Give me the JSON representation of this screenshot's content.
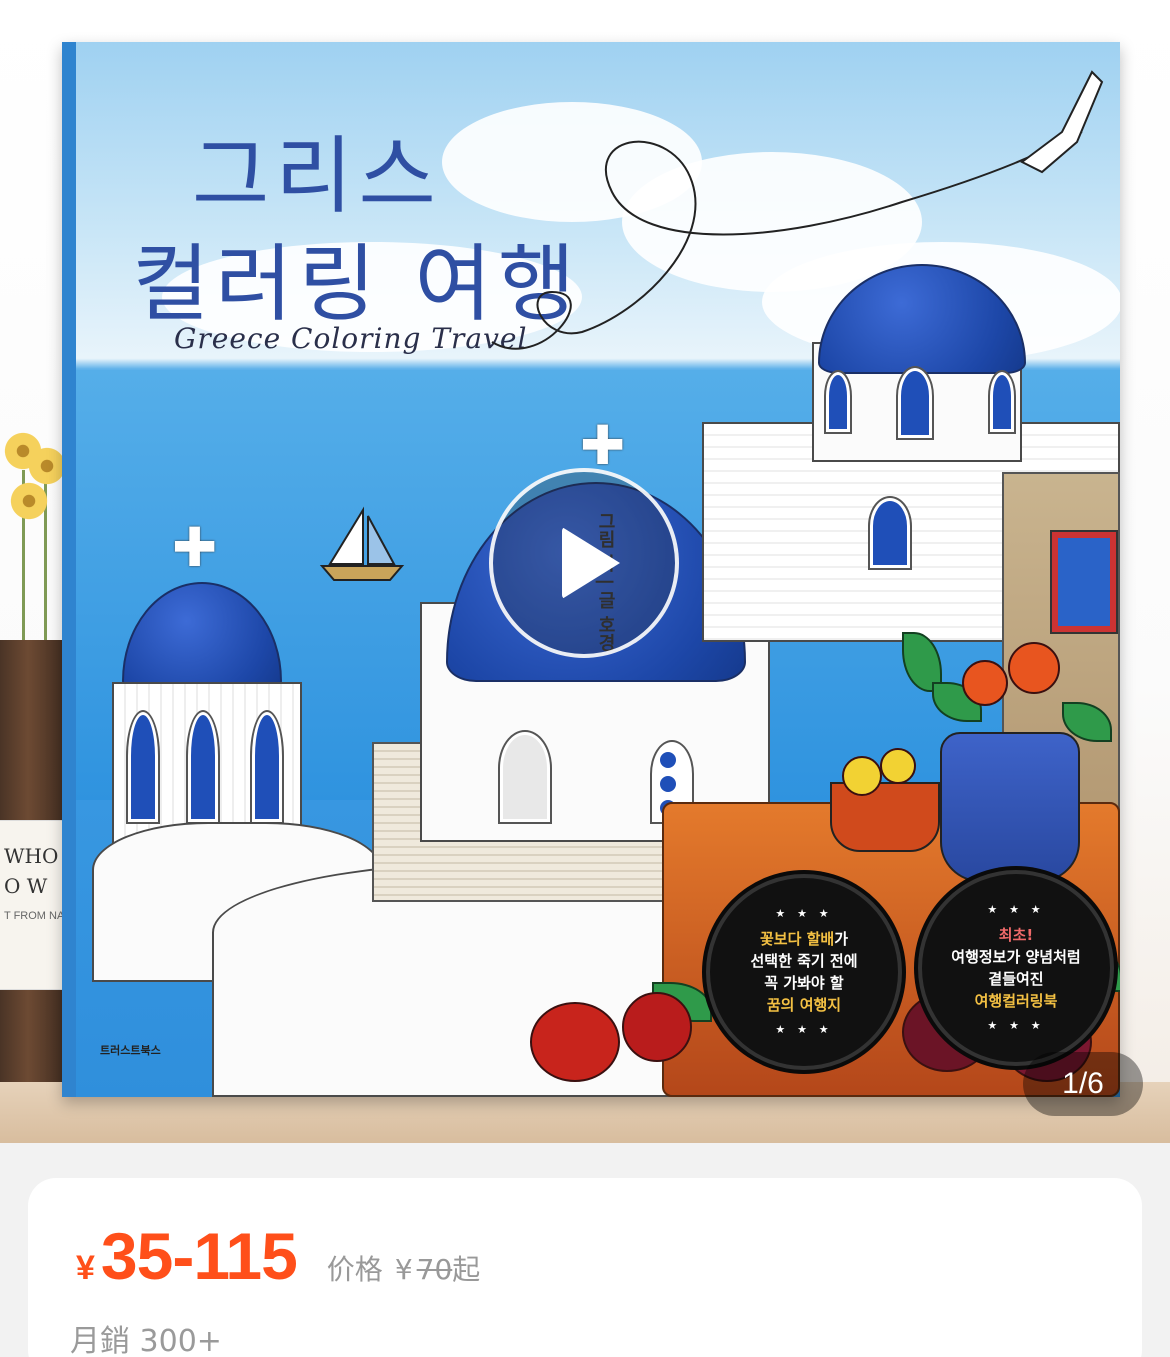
{
  "product_image": {
    "book_title_ko_line1": "그리스",
    "book_title_ko_line2": "컬러링 여행",
    "book_title_en": "Greece Coloring Travel",
    "author_text": "그림 하 | 글 호경",
    "publisher": "트러스트북스",
    "badge_left": {
      "stars_top": "★ ★ ★",
      "line1_highlight": "꽃보다 할배",
      "line1_suffix": "가",
      "line2": "선택한 죽기 전에",
      "line3": "꼭 가봐야 할",
      "line4_highlight": "꿈의 여행지",
      "stars_bottom": "★ ★ ★"
    },
    "badge_right": {
      "stars_top": "★ ★ ★",
      "line1_highlight": "최초!",
      "line2": "여행정보가 양념처럼",
      "line3": "곁들여진",
      "line4_highlight": "여행컬러링북",
      "stars_bottom": "★ ★ ★"
    },
    "shelf_label_line1": "WHO",
    "shelf_label_line2": "O W",
    "shelf_label_small": "T FROM NA",
    "page_indicator": "1/6"
  },
  "price": {
    "currency": "¥",
    "range": "35-115",
    "original_label": "价格",
    "original_currency": "¥",
    "original_price": "70",
    "original_suffix": "起",
    "monthly_sales": "月銷 300+"
  },
  "colors": {
    "price_accent": "#ff4f1a",
    "muted_text": "#999999",
    "dome_blue": "#1d47a8"
  },
  "icons": [
    "play-icon"
  ]
}
